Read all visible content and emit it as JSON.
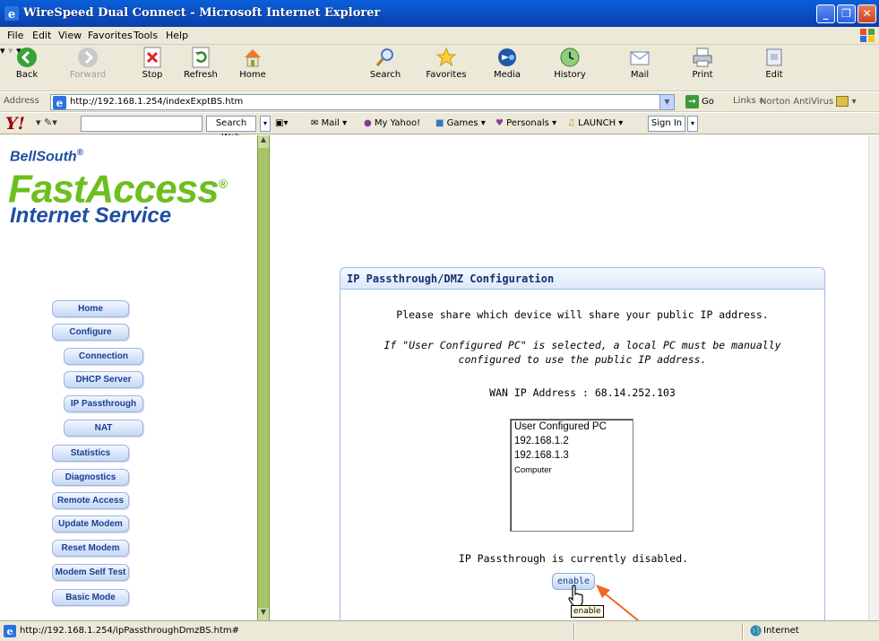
{
  "window": {
    "title": "WireSpeed Dual Connect - Microsoft Internet Explorer",
    "minimize_label": "_",
    "maximize_label": "❐",
    "close_label": "✕"
  },
  "menu": {
    "items": [
      "File",
      "Edit",
      "View",
      "Favorites",
      "Tools",
      "Help"
    ]
  },
  "toolbar": {
    "back": "Back",
    "forward": "Forward",
    "stop": "Stop",
    "refresh": "Refresh",
    "home": "Home",
    "search": "Search",
    "favorites": "Favorites",
    "media": "Media",
    "history": "History",
    "mail": "Mail",
    "print": "Print",
    "edit": "Edit"
  },
  "address": {
    "label": "Address",
    "url": "http://192.168.1.254/indexExptBS.htm",
    "go": "Go",
    "links": "Links",
    "links_chevron": "»",
    "norton": "Norton AntiVirus"
  },
  "yahoo": {
    "logo": "Y!",
    "search_web": "Search Web",
    "mail": "Mail",
    "my_yahoo": "My Yahoo!",
    "games": "Games",
    "personals": "Personals",
    "launch": "LAUNCH",
    "sign_in": "Sign In"
  },
  "brand": {
    "line1": "BellSouth",
    "line2": "FastAccess",
    "line3": "Internet Service",
    "reg": "®"
  },
  "nav": {
    "home": "Home",
    "configure": "Configure",
    "connection": "Connection",
    "dhcp_server": "DHCP Server",
    "ip_passthrough": "IP Passthrough",
    "nat": "NAT",
    "statistics": "Statistics",
    "diagnostics": "Diagnostics",
    "remote_access": "Remote Access",
    "update_modem": "Update Modem",
    "reset_modem": "Reset Modem",
    "modem_self_test": "Modem Self Test",
    "basic_mode": "Basic Mode"
  },
  "panel": {
    "title": "IP Passthrough/DMZ Configuration",
    "prompt": "Please share which device will share your public IP address.",
    "note_line1": "If \"User Configured PC\" is selected, a local PC must be manually",
    "note_line2": "configured to use the public IP address.",
    "wan_label": "WAN IP Address : 68.14.252.103",
    "devices": [
      "User Configured PC",
      "192.168.1.2",
      "192.168.1.3",
      "Computer"
    ],
    "status": "IP Passthrough is currently disabled.",
    "enable_button": "enable",
    "tooltip": "enable"
  },
  "statusbar": {
    "text": "http://192.168.1.254/ipPassthroughDmzBS.htm#",
    "zone": "Internet"
  },
  "colors": {
    "titlebar": "#0b4bc0",
    "chrome": "#ece9d8",
    "brand_blue": "#1d4fa3",
    "brand_green": "#6cbf1f",
    "nav_text": "#163f97",
    "splitter": "#a8c46b",
    "annotation_arrow": "#f26522"
  }
}
